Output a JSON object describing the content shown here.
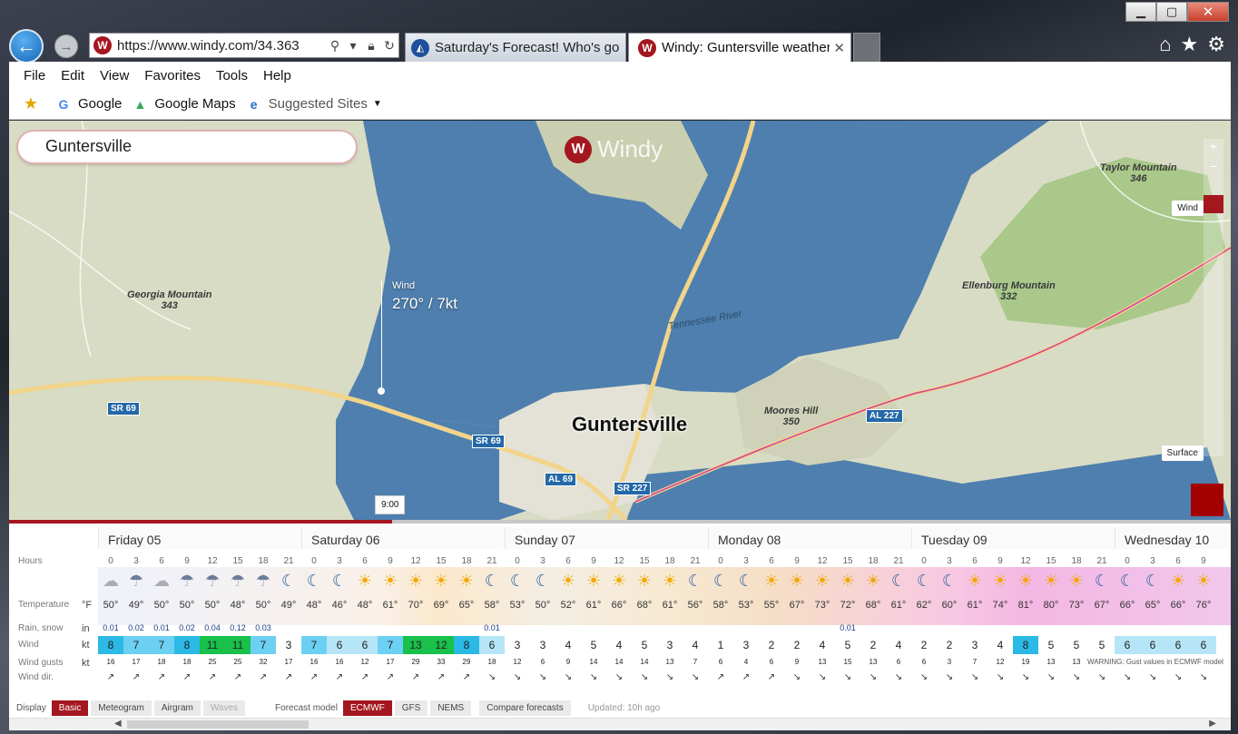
{
  "window": {
    "minimize": "▁",
    "maximize": "▢",
    "close": "✕"
  },
  "nav": {
    "back": "←",
    "forward": "→",
    "url": "https://www.windy.com/34.363"
  },
  "tabs": [
    {
      "label": "Saturday's Forecast! Who's goi...",
      "close": ""
    },
    {
      "label": "Windy: Guntersville weather...",
      "close": "✕"
    }
  ],
  "toolbar_right": [
    "home-icon",
    "star-icon",
    "gear-icon"
  ],
  "menu": [
    "File",
    "Edit",
    "View",
    "Favorites",
    "Tools",
    "Help"
  ],
  "favorites": {
    "google": "Google",
    "google_maps": "Google Maps",
    "suggested": "Suggested Sites"
  },
  "map": {
    "search_value": "Guntersville",
    "brand": "Windy",
    "wind_label": "Wind",
    "wind_value": "270° / 7kt",
    "town": "Guntersville",
    "river": "Tennessee River",
    "places": [
      {
        "name": "Georgia Mountain",
        "elev": "343"
      },
      {
        "name": "Taylor Mountain",
        "elev": "346"
      },
      {
        "name": "Ellenburg Mountain",
        "elev": "332"
      },
      {
        "name": "Moores Hill",
        "elev": "350"
      }
    ],
    "roads": [
      "SR 69",
      "SR 69",
      "AL 69",
      "SR 227",
      "AL 227"
    ],
    "overlay_wind": "Wind",
    "overlay_surface": "Surface",
    "time_marker": "9:00"
  },
  "forecast": {
    "days": [
      "Friday 05",
      "Saturday 06",
      "Sunday 07",
      "Monday 08",
      "Tuesday 09",
      "Wednesday 10"
    ],
    "labels": {
      "hours": "Hours",
      "temperature": "Temperature",
      "temp_unit": "°F",
      "rain": "Rain, snow",
      "rain_unit": "in",
      "wind": "Wind",
      "wind_unit": "kt",
      "gusts": "Wind gusts",
      "gusts_unit": "kt",
      "dir": "Wind dir."
    },
    "hours": [
      "0",
      "3",
      "6",
      "9",
      "12",
      "15",
      "18",
      "21",
      "0",
      "3",
      "6",
      "9",
      "12",
      "15",
      "18",
      "21",
      "0",
      "3",
      "6",
      "9",
      "12",
      "15",
      "18",
      "21",
      "0",
      "3",
      "6",
      "9",
      "12",
      "15",
      "18",
      "21",
      "0",
      "3",
      "6",
      "9",
      "12",
      "15",
      "18",
      "21",
      "0",
      "3",
      "6",
      "9"
    ],
    "icons": [
      "cloud",
      "rain",
      "cloud",
      "rain",
      "rain",
      "rain",
      "rain",
      "moon",
      "moon",
      "moon",
      "sun",
      "sun",
      "sun",
      "sun",
      "sun",
      "moon",
      "moon",
      "moon",
      "sun",
      "sun",
      "sun",
      "sun",
      "sun",
      "moon",
      "moon",
      "moon",
      "sun",
      "sun",
      "sun",
      "sun",
      "sun",
      "moon",
      "moon",
      "moon",
      "sun",
      "sun",
      "sun",
      "sun",
      "sun",
      "moon",
      "moon",
      "moon",
      "sun",
      "sun"
    ],
    "temps": [
      "50°",
      "49°",
      "50°",
      "50°",
      "50°",
      "48°",
      "50°",
      "49°",
      "48°",
      "46°",
      "48°",
      "61°",
      "70°",
      "69°",
      "65°",
      "58°",
      "53°",
      "50°",
      "52°",
      "61°",
      "66°",
      "68°",
      "61°",
      "56°",
      "58°",
      "53°",
      "55°",
      "67°",
      "73°",
      "72°",
      "68°",
      "61°",
      "62°",
      "60°",
      "61°",
      "74°",
      "81°",
      "80°",
      "73°",
      "67°",
      "66°",
      "65°",
      "66°",
      "76°"
    ],
    "rain": [
      "0.01",
      "0.02",
      "0.01",
      "0.02",
      "0.04",
      "0.12",
      "0.03",
      "",
      "",
      "",
      "",
      "",
      "",
      "",
      "",
      "0.01",
      "",
      "",
      "",
      "",
      "",
      "",
      "",
      "",
      "",
      "",
      "",
      "",
      "",
      "0.01",
      "",
      "",
      "",
      "",
      "",
      "",
      "",
      "",
      "",
      "",
      "",
      "",
      "",
      ""
    ],
    "wind": [
      "8",
      "7",
      "7",
      "8",
      "11",
      "11",
      "7",
      "3",
      "7",
      "6",
      "6",
      "7",
      "13",
      "12",
      "8",
      "6",
      "3",
      "3",
      "4",
      "5",
      "4",
      "5",
      "3",
      "4",
      "1",
      "3",
      "2",
      "2",
      "4",
      "5",
      "2",
      "4",
      "2",
      "2",
      "3",
      "4",
      "8",
      "5",
      "5",
      "5",
      "6",
      "6",
      "6",
      "6"
    ],
    "gusts": [
      "16",
      "17",
      "18",
      "18",
      "25",
      "25",
      "32",
      "17",
      "16",
      "16",
      "12",
      "17",
      "29",
      "33",
      "29",
      "18",
      "12",
      "6",
      "9",
      "14",
      "14",
      "14",
      "13",
      "7",
      "6",
      "4",
      "6",
      "9",
      "13",
      "15",
      "13",
      "6",
      "6",
      "3",
      "7",
      "12",
      "19",
      "13",
      "13",
      "",
      "",
      "",
      "",
      ""
    ],
    "gust_warning": "WARNING: Gust values in ECMWF model",
    "dirs": [
      "↗",
      "↗",
      "↗",
      "↗",
      "↗",
      "↗",
      "↗",
      "↗",
      "↗",
      "↗",
      "↗",
      "↗",
      "↗",
      "↗",
      "↗",
      "↘",
      "↘",
      "↘",
      "↘",
      "↘",
      "↘",
      "↘",
      "↘",
      "↘",
      "↗",
      "↗",
      "↗",
      "↘",
      "↘",
      "↘",
      "↘",
      "↘",
      "↘",
      "↘",
      "↘",
      "↘",
      "↘",
      "↘",
      "↘",
      "↘",
      "↘",
      "↘",
      "↘",
      "↘"
    ]
  },
  "bottom": {
    "display_label": "Display",
    "display_opts": [
      "Basic",
      "Meteogram",
      "Airgram",
      "Waves"
    ],
    "model_label": "Forecast model",
    "model_opts": [
      "ECMWF",
      "GFS",
      "NEMS"
    ],
    "compare": "Compare forecasts",
    "updated": "Updated: 10h ago"
  },
  "colors": {
    "brand": "#a4171f",
    "water": "#4f7fae",
    "land": "#d8dcc4"
  }
}
